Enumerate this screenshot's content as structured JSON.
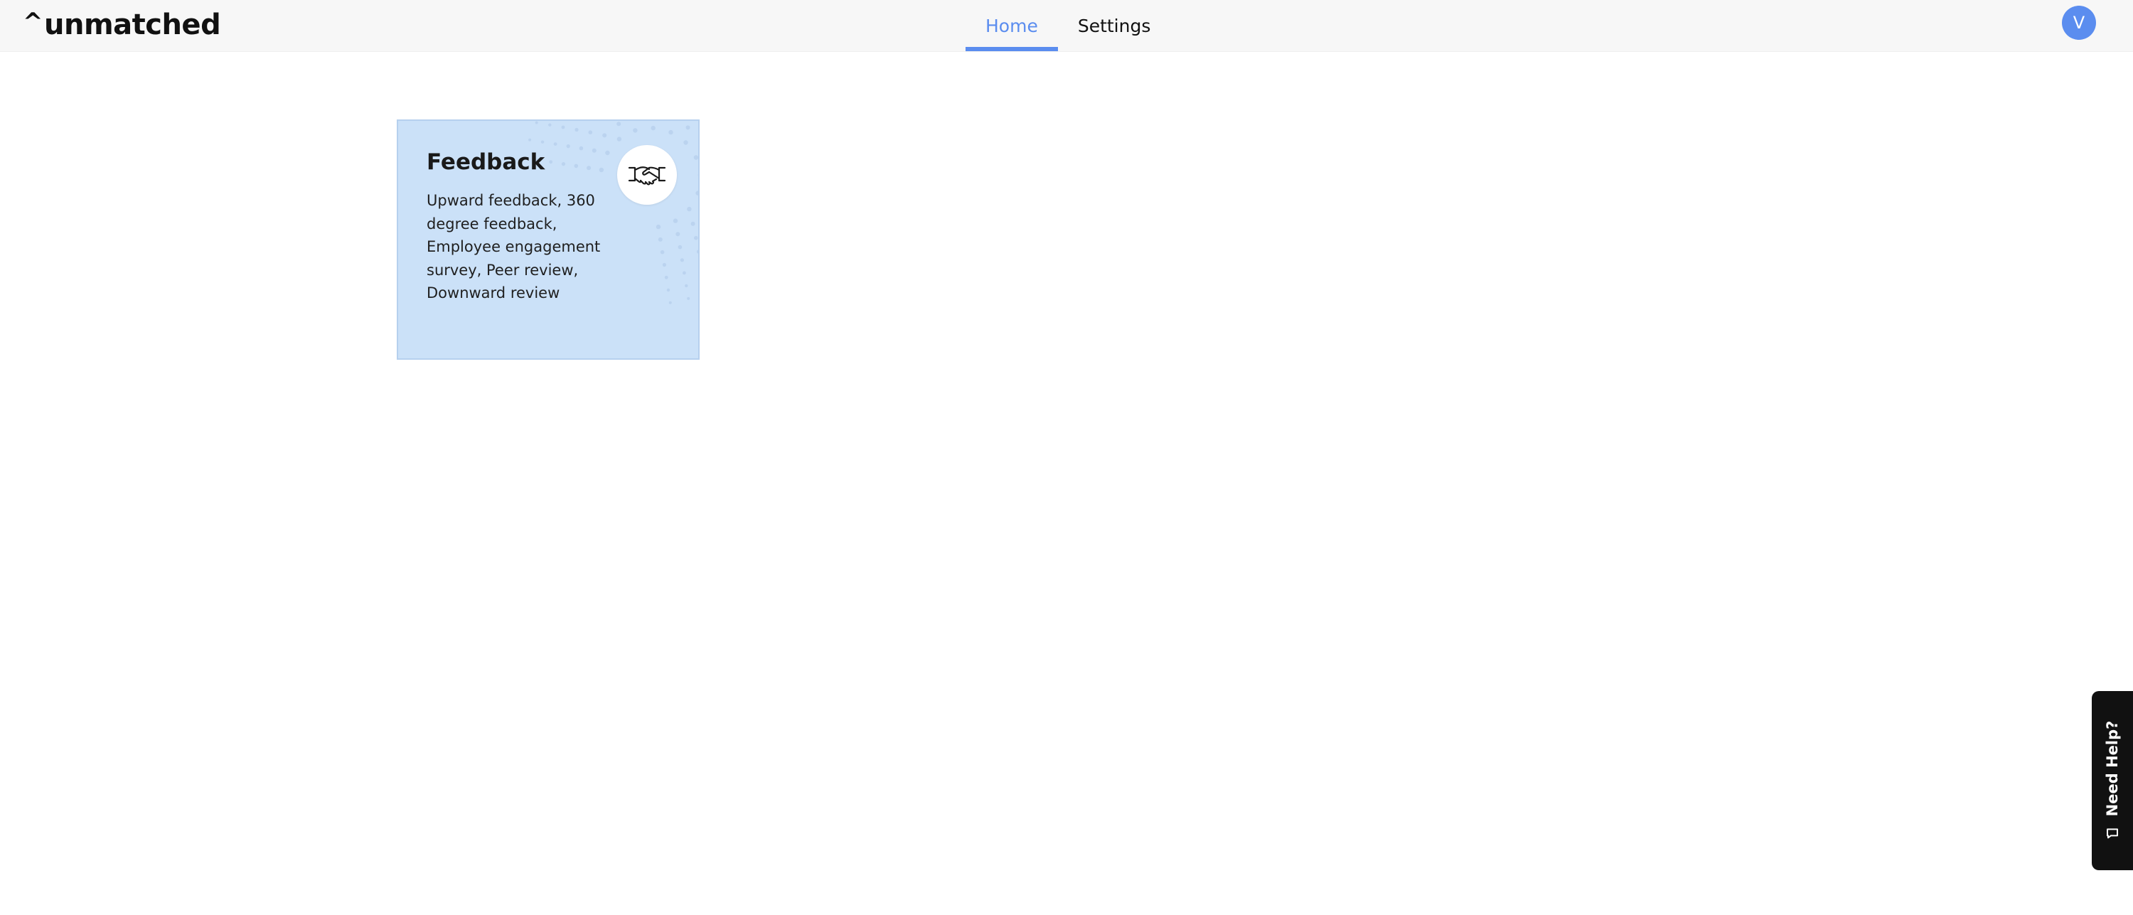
{
  "header": {
    "logo_text": "unmatched",
    "logo_caret": "^",
    "tabs": [
      {
        "label": "Home",
        "active": true
      },
      {
        "label": "Settings",
        "active": false
      }
    ],
    "avatar_initial": "V"
  },
  "main": {
    "cards": [
      {
        "title": "Feedback",
        "description": "Upward feedback, 360 degree feedback, Employee engagement survey, Peer review, Downward review",
        "icon": "handshake-icon"
      }
    ]
  },
  "help": {
    "label": "Need Help?",
    "icon": "chat-bubble-icon"
  },
  "colors": {
    "accent": "#5b8def",
    "card_bg": "#cbe1f8",
    "help_bg": "#111111",
    "header_bg": "#f7f7f7"
  }
}
